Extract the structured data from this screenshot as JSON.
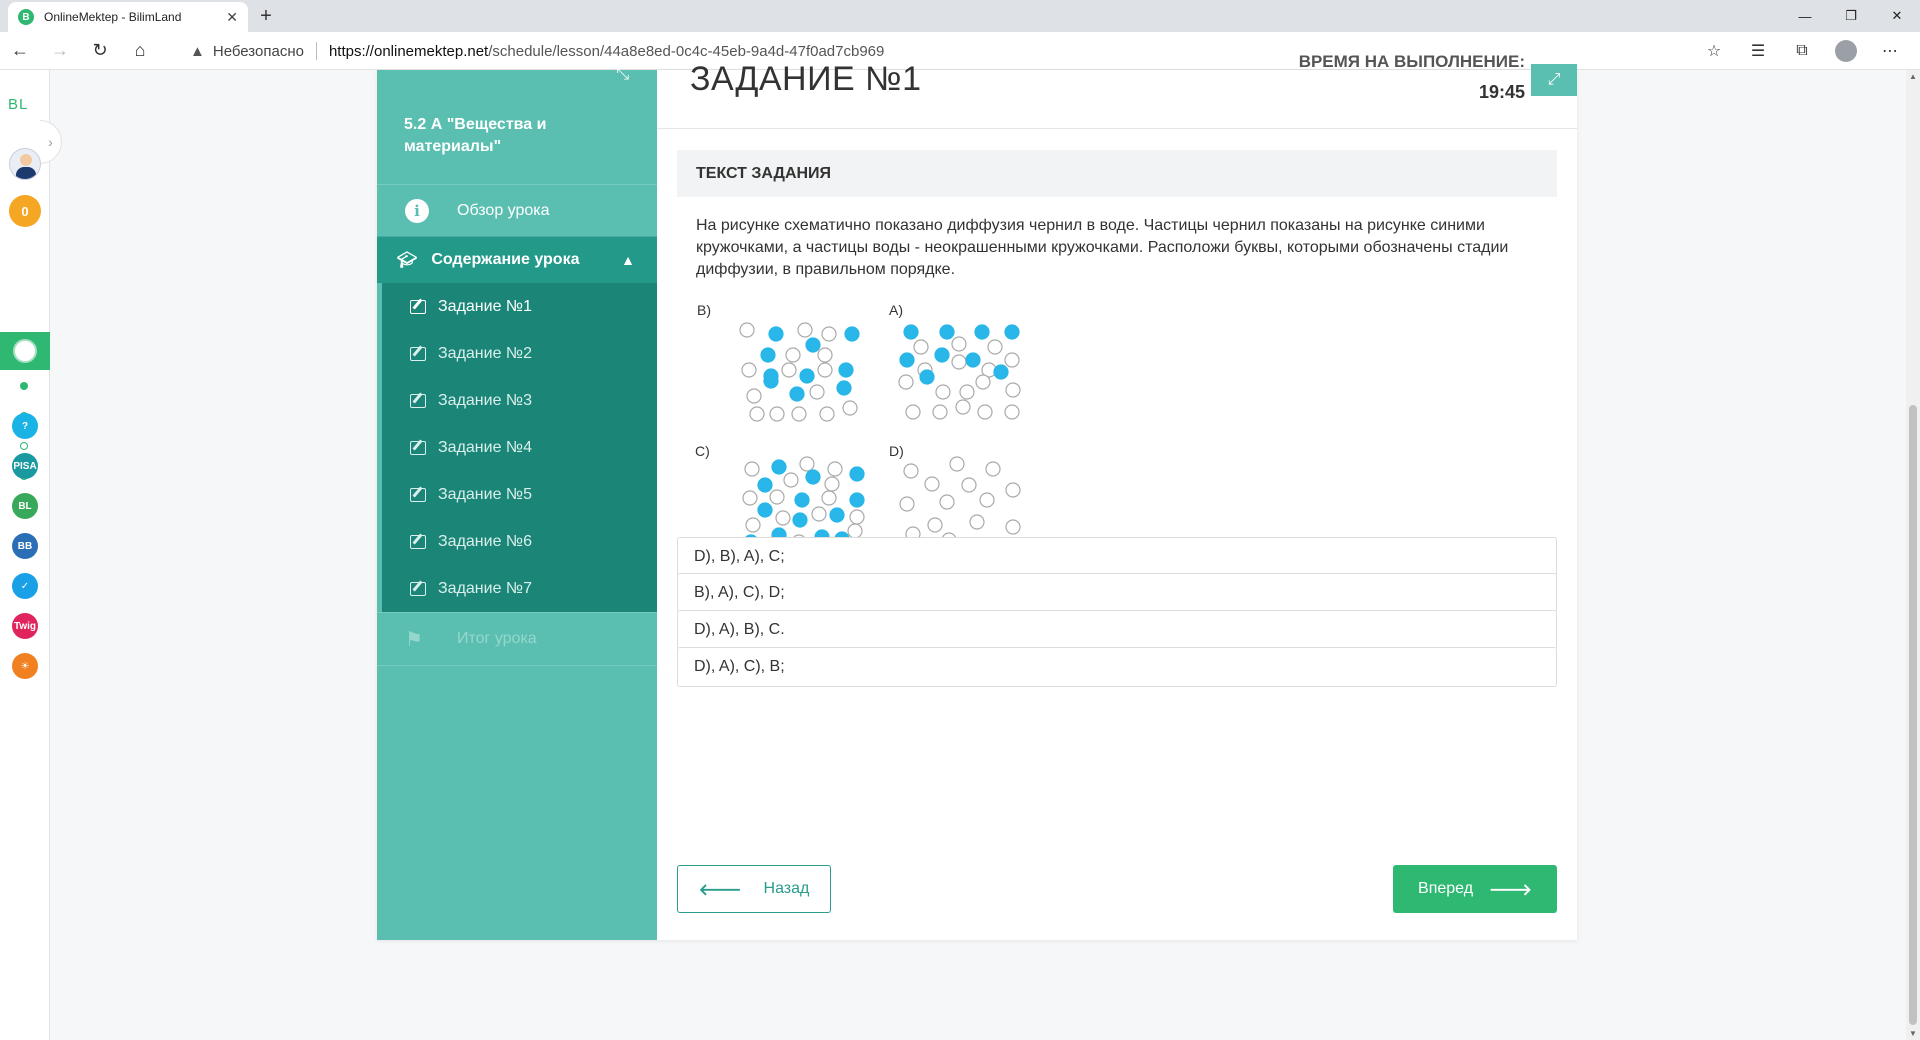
{
  "browser": {
    "tab_title": "OnlineMektep - BilimLand",
    "favicon_letter": "B",
    "new_tab": "+",
    "insecure_label": "Небезопасно",
    "url_domain": "https://onlinemektep.net",
    "url_path": "/schedule/lesson/44a8e8ed-0c4c-45eb-9a4d-47f0ad7cb969"
  },
  "rail": {
    "logo": "BL",
    "coins": "0",
    "apps": [
      {
        "name": "help",
        "label": "?",
        "color": "#1ab3e6"
      },
      {
        "name": "app-2",
        "label": "PISA",
        "color": "#1a9aa0"
      },
      {
        "name": "app-3",
        "label": "BL",
        "color": "#38a85a"
      },
      {
        "name": "app-4",
        "label": "BB",
        "color": "#2a6fb5"
      },
      {
        "name": "app-5",
        "label": "✓",
        "color": "#1aa0e6"
      },
      {
        "name": "app-6",
        "label": "Twig",
        "color": "#e0245e"
      },
      {
        "name": "app-7",
        "label": "☀",
        "color": "#f08020"
      }
    ]
  },
  "sidebar": {
    "course_title": "5.2 А \"Вещества и материалы\"",
    "overview": "Обзор урока",
    "contents": "Содержание урока",
    "tasks": [
      "Задание №1",
      "Задание №2",
      "Задание №3",
      "Задание №4",
      "Задание №5",
      "Задание №6",
      "Задание №7"
    ],
    "summary": "Итог урока"
  },
  "main": {
    "heading": "ЗАДАНИЕ №1",
    "timer_label": "ВРЕМЯ НА ВЫПОЛНЕНИЕ:",
    "timer": "19:45",
    "task_head": "ТЕКСТ ЗАДАНИЯ",
    "task_text": "На рисунке схематично показано диффузия чернил в воде. Частицы чернил показаны на рисунке синими кружочками, а частицы воды - неокрашенными кружочками. Расположи буквы, которыми обозначены стадии диффузии, в правильном порядке.",
    "figure_labels": {
      "b": "B)",
      "a": "A)",
      "c": "C)",
      "d": "D)"
    },
    "answers": [
      "D), B), A), C;",
      "B), A), C), D;",
      "D), A), B), C.",
      "D), A), C), B;"
    ],
    "back": "Назад",
    "next": "Вперед",
    "ink_color": "#29b6e8"
  }
}
